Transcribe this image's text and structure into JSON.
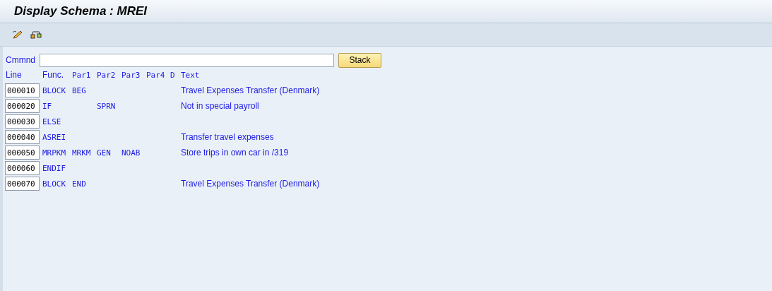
{
  "window": {
    "title": "Display Schema : MREI"
  },
  "toolbar": {
    "buttons": [
      {
        "kind": "edit"
      },
      {
        "kind": "hierarchy"
      }
    ]
  },
  "command": {
    "label": "Cmmnd",
    "button": "Stack"
  },
  "table": {
    "columns": [
      {
        "label": "Line",
        "kind": "sans"
      },
      {
        "label": "Func.",
        "kind": "sans"
      },
      {
        "label": "Par1",
        "kind": "mono"
      },
      {
        "label": "Par2",
        "kind": "mono"
      },
      {
        "label": "Par3",
        "kind": "mono"
      },
      {
        "label": "Par4",
        "kind": "mono"
      },
      {
        "label": "D",
        "kind": "mono"
      },
      {
        "label": "Text",
        "kind": "mono"
      }
    ],
    "rows": [
      {
        "line": "000010",
        "func": "BLOCK",
        "par1": "BEG",
        "text": "Travel Expenses Transfer (Denmark)"
      },
      {
        "line": "000020",
        "func": "IF",
        "par2": "SPRN",
        "text": "Not in special payroll"
      },
      {
        "line": "000030",
        "func": "ELSE"
      },
      {
        "line": "000040",
        "func": "ASREI",
        "text": "Transfer travel expenses"
      },
      {
        "line": "000050",
        "func": "MRPKM",
        "par1": "MRKM",
        "par2": "GEN",
        "par3": "NOAB",
        "text": "Store trips in own car in /319"
      },
      {
        "line": "000060",
        "func": "ENDIF"
      },
      {
        "line": "000070",
        "func": "BLOCK",
        "par1": "END",
        "text": "Travel Expenses Transfer (Denmark)"
      }
    ]
  }
}
